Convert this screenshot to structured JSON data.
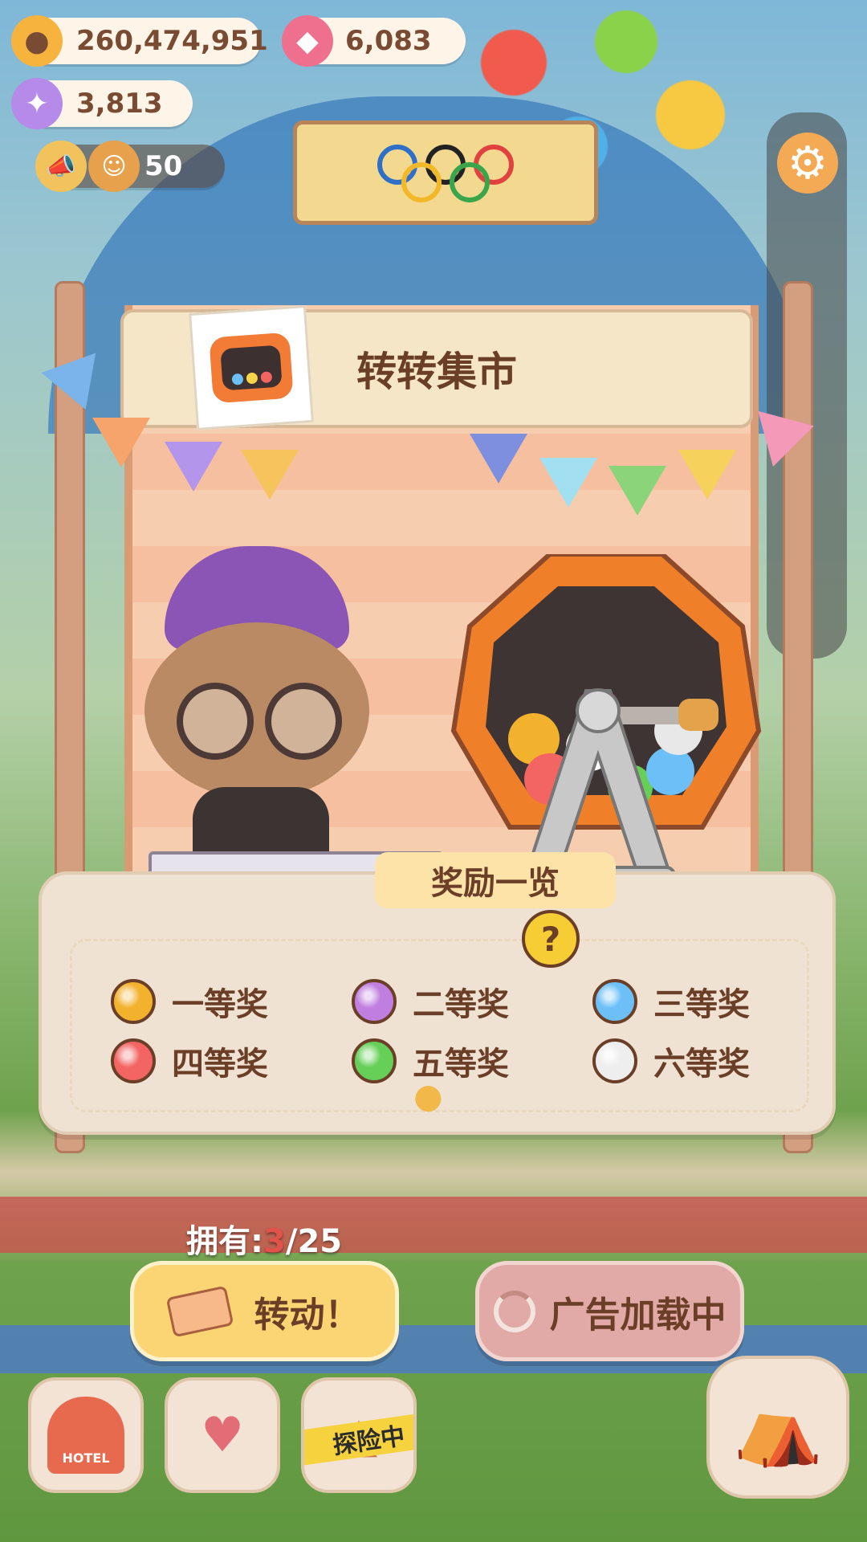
{
  "currency": {
    "cookies": "260,474,951",
    "gems": "6,083",
    "candy": "3,813",
    "energy": "50"
  },
  "event_banner": {
    "label": "Olympic rings"
  },
  "booth": {
    "title": "转转集市",
    "tv_icon": "tv-icon"
  },
  "prize_list": {
    "title": "奖励一览",
    "help_icon": "?",
    "prizes": [
      {
        "label": "一等奖",
        "color": "#f2b22e"
      },
      {
        "label": "二等奖",
        "color": "#c07fe0"
      },
      {
        "label": "三等奖",
        "color": "#6cc0f7"
      },
      {
        "label": "四等奖",
        "color": "#f26563"
      },
      {
        "label": "五等奖",
        "color": "#66cf58"
      },
      {
        "label": "六等奖",
        "color": "#eeeeee"
      }
    ]
  },
  "owned": {
    "prefix": "拥有:",
    "current": "3",
    "total": "/25"
  },
  "buttons": {
    "spin": "转动！",
    "ad": "广告加载中"
  },
  "bottom_bar": {
    "hotel_label": "HOTEL",
    "explore_label": "探险中"
  },
  "colors": {
    "accent": "#fbd574",
    "text_brown": "#6b3e27",
    "owned_red": "#e0524a"
  }
}
